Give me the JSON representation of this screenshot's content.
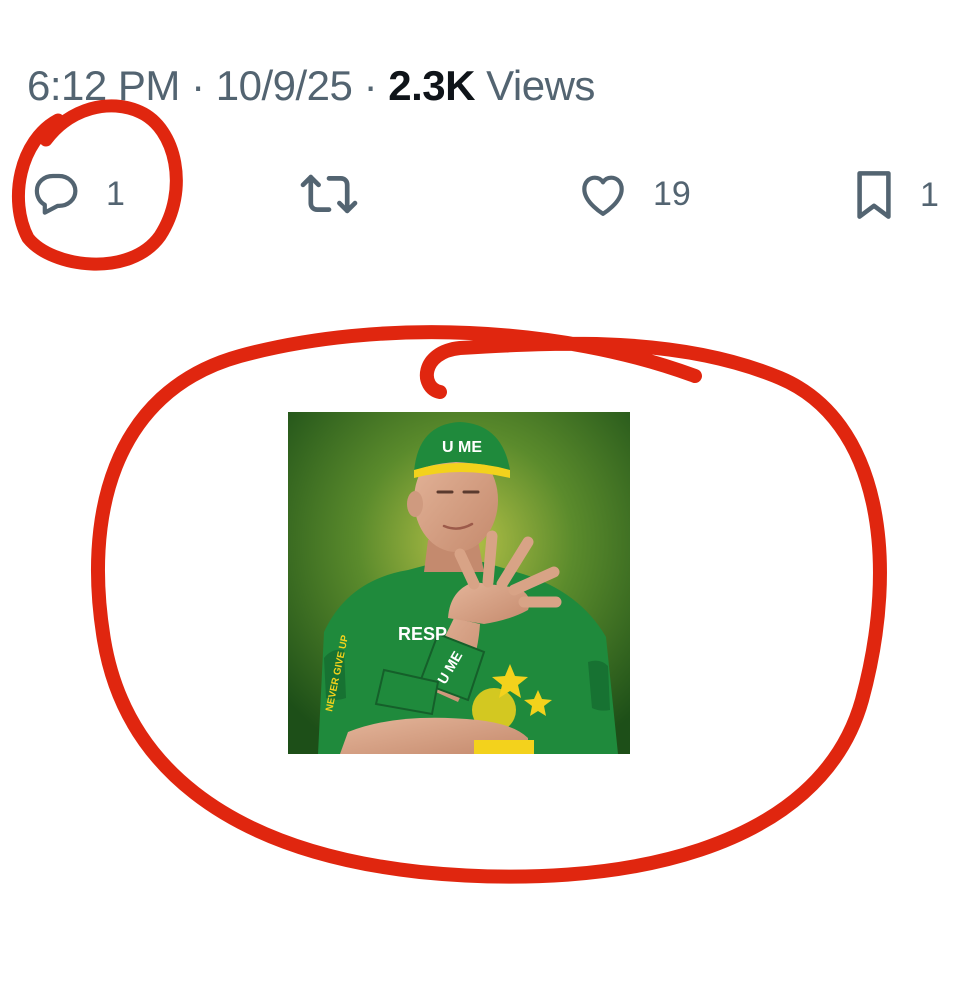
{
  "tweet": {
    "time": "6:12 PM",
    "date": "10/9/25",
    "separator": "·",
    "views_count": "2.3K",
    "views_label": "Views"
  },
  "actions": {
    "reply": {
      "icon": "reply-icon",
      "count": "1"
    },
    "repost": {
      "icon": "repost-icon",
      "count": ""
    },
    "like": {
      "icon": "heart-icon",
      "count": "19"
    },
    "bookmark": {
      "icon": "bookmark-icon",
      "count": "1"
    }
  },
  "media": {
    "cap_text": "U ME",
    "shirt_text": "RESP",
    "wristband_text": "U ME",
    "sleeve_text": "NEVER GIVE UP"
  },
  "colors": {
    "icon_gray": "#536471",
    "text_dark": "#0f1419",
    "annotation_red": "#e0260f",
    "shirt_green": "#1f8a3c",
    "background_green": "#2f6a1f",
    "accent_yellow": "#f3d21c"
  }
}
